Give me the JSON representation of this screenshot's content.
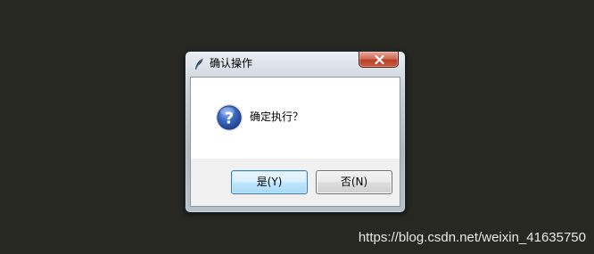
{
  "dialog": {
    "title": "确认操作",
    "title_icon": "feather-icon",
    "close_icon": "close-icon",
    "message_icon": "question-icon",
    "message": "确定执行？",
    "buttons": {
      "yes_label": "是(Y)",
      "no_label": "否(N)"
    }
  },
  "watermark": {
    "text": "https://blog.csdn.net/weixin_41635750"
  },
  "colors": {
    "background": "#272822",
    "close_button": "#c85a3e",
    "default_button_border": "#3c7fb1",
    "question_icon": "#2a54a8"
  }
}
